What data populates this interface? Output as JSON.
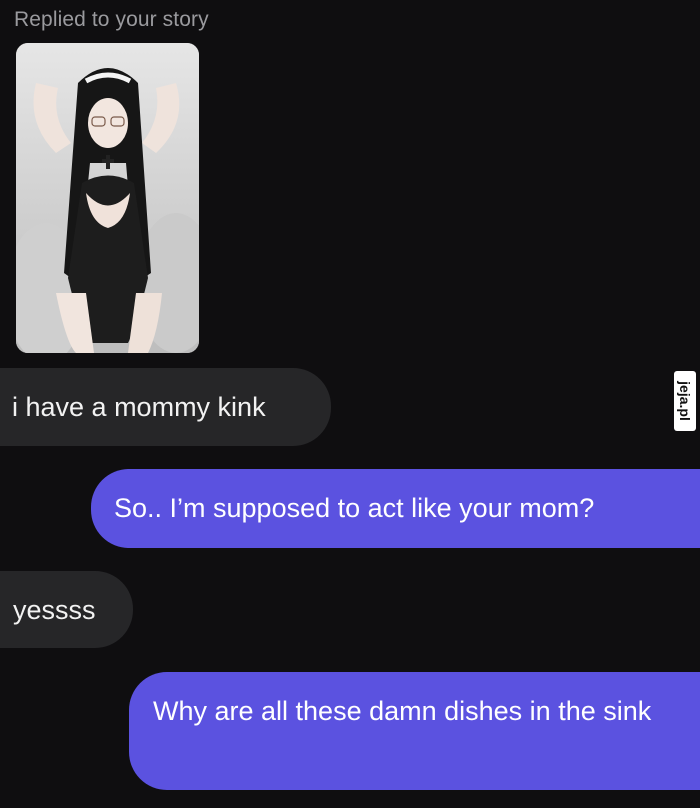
{
  "story_reply": {
    "caption": "Replied to your story",
    "image_alt": "story photo"
  },
  "messages": [
    {
      "direction": "incoming",
      "text": "i have a mommy kink"
    },
    {
      "direction": "outgoing",
      "text": "So.. I’m supposed to act like your mom?"
    },
    {
      "direction": "incoming",
      "text": "yessss"
    },
    {
      "direction": "outgoing",
      "text": "Why are all these damn dishes in the sink"
    }
  ],
  "watermark": {
    "text": "jeja.pl"
  },
  "colors": {
    "background": "#0f0e10",
    "incoming_bubble": "#262628",
    "outgoing_bubble": "#5b52e0",
    "caption_text": "#9a9a9e"
  }
}
